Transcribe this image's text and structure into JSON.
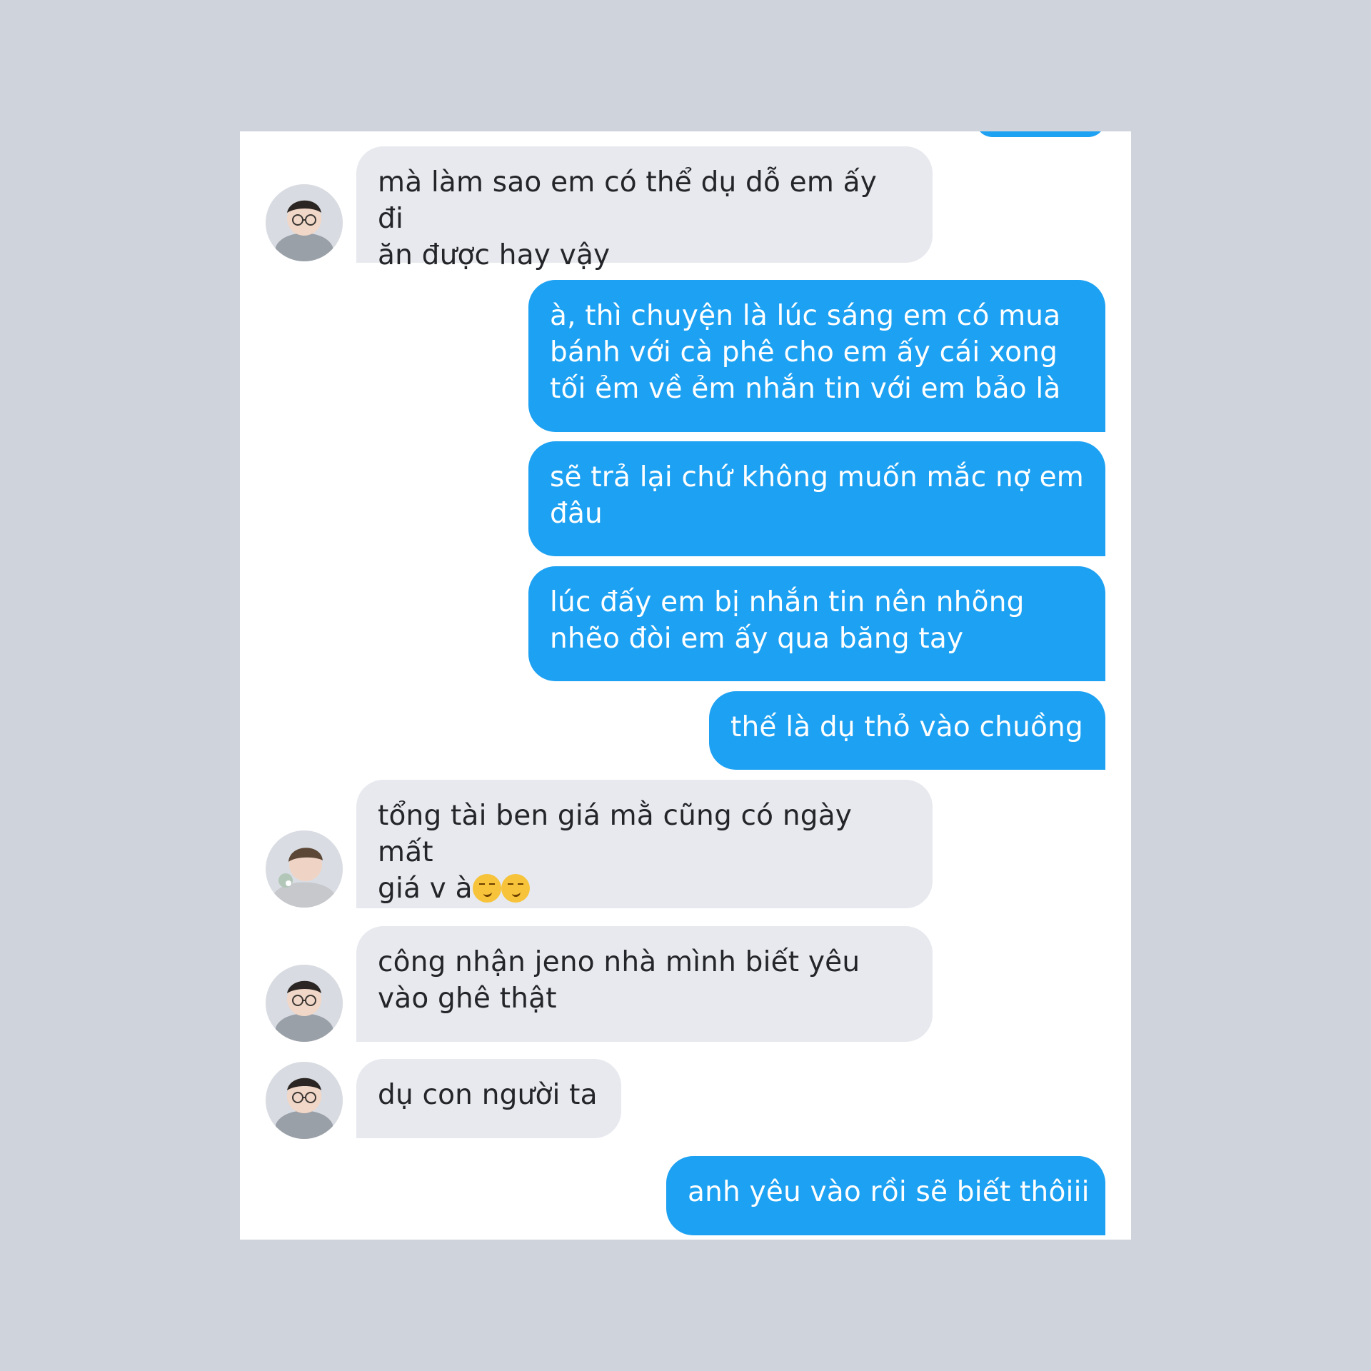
{
  "messages": [
    {
      "from": "received",
      "text": "mà làm sao em có thể dụ dỗ em ấy đi\năn được hay vậy"
    },
    {
      "from": "sent",
      "text": "à, thì chuyện là lúc sáng em có mua\nbánh với cà phê cho em ấy cái xong\ntối ẻm về ẻm nhắn tin với em bảo là"
    },
    {
      "from": "sent",
      "text": "sẽ trả lại chứ không muốn mắc nợ em\nđâu"
    },
    {
      "from": "sent",
      "text": "lúc đấy em bị nhắn tin nên nhõng\nnhẽo đòi em ấy qua băng tay"
    },
    {
      "from": "sent",
      "text": "thế là dụ thỏ vào chuồng"
    },
    {
      "from": "received",
      "text": "tổng tài ben giá mằ cũng có ngày mất\ngiá v à",
      "emoji": [
        "smirking-face",
        "smirking-face"
      ]
    },
    {
      "from": "received",
      "text": "công nhận jeno nhà mình biết yêu\nvào ghê thật"
    },
    {
      "from": "received",
      "text": "dụ con người ta"
    },
    {
      "from": "sent",
      "text": "anh yêu vào rồi sẽ biết thôiii"
    }
  ],
  "colors": {
    "background": "#cfd3dc",
    "panel": "#ffffff",
    "received_bubble": "#e7e9ee",
    "sent_bubble": "#1da1f2"
  },
  "icons": {
    "avatar": "profile-avatar",
    "emoji": "smirking-face"
  }
}
